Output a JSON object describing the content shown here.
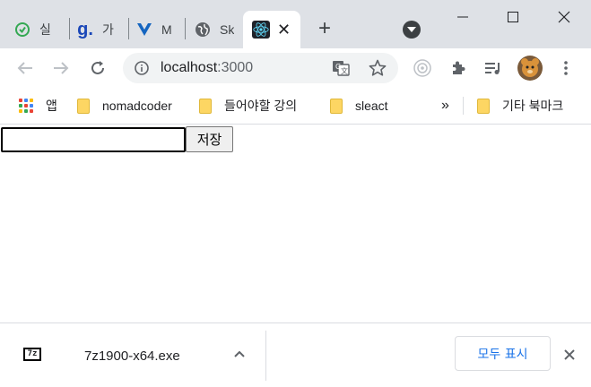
{
  "tabs": [
    {
      "title": "실",
      "icon": "green-circle-icon"
    },
    {
      "title": "가",
      "icon": "g-logo-icon"
    },
    {
      "title": "M",
      "icon": "v-logo-icon"
    },
    {
      "title": "Sk",
      "icon": "globe-icon"
    },
    {
      "title": "",
      "icon": "react-icon",
      "active": true
    }
  ],
  "toolbar": {
    "url_host": "localhost",
    "url_port": ":3000"
  },
  "bookmarks": {
    "apps_label": "앱",
    "items": [
      "nomadcoder",
      "들어야할 강의",
      "sleact"
    ],
    "overflow_label": "»",
    "other_label": "기타 북마크"
  },
  "page": {
    "input_value": "",
    "save_label": "저장"
  },
  "downloads": {
    "icon_text": "7z",
    "filename": "7z1900-x64.exe",
    "show_all_label": "모두 표시"
  },
  "colors": {
    "tabstrip": "#dee1e6",
    "accent": "#1a73e8",
    "react": "#61dafb",
    "folder": "#fdd663"
  }
}
